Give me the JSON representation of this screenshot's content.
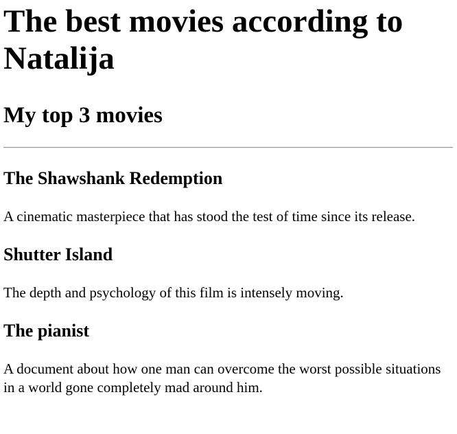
{
  "page": {
    "title": "The best movies according to Natalija",
    "subtitle": "My top 3 movies"
  },
  "movies": [
    {
      "title": "The Shawshank Redemption",
      "description": "A cinematic masterpiece that has stood the test of time since its release."
    },
    {
      "title": "Shutter Island",
      "description": "The depth and psychology of this film is intensely moving."
    },
    {
      "title": "The pianist",
      "description": "A document about how one man can overcome the worst possible situations in a world gone completely mad around him."
    }
  ]
}
